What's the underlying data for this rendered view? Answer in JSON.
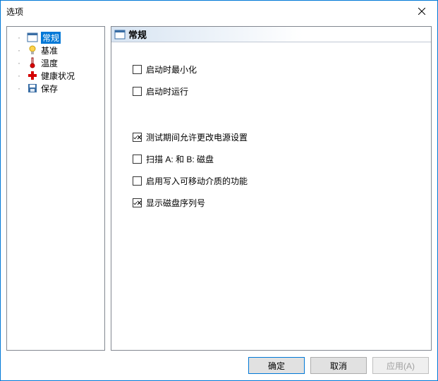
{
  "window": {
    "title": "选项"
  },
  "tree": {
    "items": [
      {
        "id": "general",
        "label": "常规",
        "icon": "window-icon",
        "selected": true
      },
      {
        "id": "baseline",
        "label": "基准",
        "icon": "bulb-icon",
        "selected": false
      },
      {
        "id": "temp",
        "label": "温度",
        "icon": "thermo-icon",
        "selected": false
      },
      {
        "id": "health",
        "label": "健康状况",
        "icon": "redcross-icon",
        "selected": false
      },
      {
        "id": "save",
        "label": "保存",
        "icon": "floppy-icon",
        "selected": false
      }
    ]
  },
  "panel": {
    "header_icon": "window-icon",
    "title": "常规",
    "checkboxes": [
      {
        "id": "start_min",
        "label": "启动时最小化",
        "checked": false
      },
      {
        "id": "start_run",
        "label": "启动时运行",
        "checked": false
      },
      {
        "id": "spacer",
        "spacer": true
      },
      {
        "id": "power",
        "label": "测试期间允许更改电源设置",
        "checked": true
      },
      {
        "id": "scan_ab",
        "label": "扫描 A: 和 B: 磁盘",
        "checked": false
      },
      {
        "id": "removable",
        "label": "启用写入可移动介质的功能",
        "checked": false
      },
      {
        "id": "show_serial",
        "label": "显示磁盘序列号",
        "checked": true
      }
    ]
  },
  "buttons": {
    "ok": "确定",
    "cancel": "取消",
    "apply": "应用(A)"
  }
}
